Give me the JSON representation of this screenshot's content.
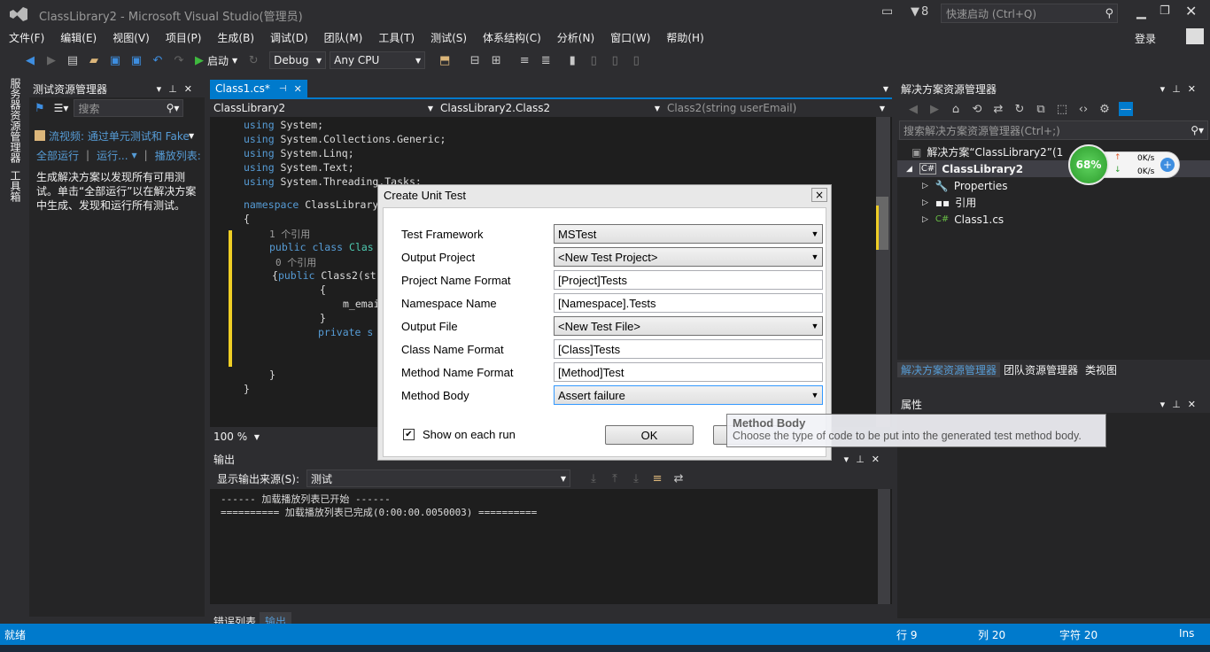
{
  "window": {
    "title": "ClassLibrary2 - Microsoft Visual Studio(管理员)",
    "notify_count": "8",
    "quick_launch": "快速启动 (Ctrl+Q)",
    "login": "登录"
  },
  "menu": [
    "文件(F)",
    "编辑(E)",
    "视图(V)",
    "项目(P)",
    "生成(B)",
    "调试(D)",
    "团队(M)",
    "工具(T)",
    "测试(S)",
    "体系结构(C)",
    "分析(N)",
    "窗口(W)",
    "帮助(H)"
  ],
  "toolbar": {
    "start": "启动",
    "config": "Debug",
    "platform": "Any CPU"
  },
  "side_tabs": {
    "server": "服务器资源管理器",
    "toolbox": "工具箱"
  },
  "test_explorer": {
    "title": "测试资源管理器",
    "search_placeholder": "搜索",
    "video_link": "流视频: 通过单元测试和 Fake",
    "run_all": "全部运行",
    "run": "运行...",
    "playlist": "播放列表:",
    "message": "生成解决方案以发现所有可用测试。单击“全部运行”以在解决方案中生成、发现和运行所有测试。"
  },
  "editor": {
    "tab": "Class1.cs*",
    "nav_project": "ClassLibrary2",
    "nav_class": "ClassLibrary2.Class2",
    "nav_member": "Class2(string userEmail)",
    "zoom": "100 %",
    "lines": [
      {
        "kw": "using",
        "rest": " System;"
      },
      {
        "kw": "using",
        "rest": " System.Collections.Generic;"
      },
      {
        "kw": "using",
        "rest": " System.Linq;"
      },
      {
        "kw": "using",
        "rest": " System.Text;"
      },
      {
        "kw": "using",
        "rest": " System.Threading.Tasks;"
      }
    ],
    "ns_kw": "namespace",
    "ns_name": " ClassLibrary",
    "ref1": "1 个引用",
    "class_kw": "public class",
    "class_name": " Clas",
    "ref0": "0 个引用",
    "ctor_kw": "public",
    "ctor_rest": " Class2(st",
    "assign": "m_emai",
    "private_kw": "private s"
  },
  "output": {
    "title": "输出",
    "source_label": "显示输出来源(S):",
    "source_value": "测试",
    "lines": [
      "------ 加载播放列表已开始 ------",
      "========== 加载播放列表已完成(0:00:00.0050003) =========="
    ],
    "tab_errors": "错误列表",
    "tab_output": "输出"
  },
  "solution_explorer": {
    "title": "解决方案资源管理器",
    "search": "搜索解决方案资源管理器(Ctrl+;)",
    "solution": "解决方案“ClassLibrary2”(1",
    "project": "ClassLibrary2",
    "properties": "Properties",
    "references": "引用",
    "file": "Class1.cs",
    "tabs": [
      "解决方案资源管理器",
      "团队资源管理器",
      "类视图"
    ],
    "properties_panel": "属性"
  },
  "net_widget": {
    "percent": "68%",
    "up": "0K/s",
    "down": "0K/s"
  },
  "dialog": {
    "title": "Create Unit Test",
    "fields": [
      {
        "label": "Test Framework",
        "value": "MSTest",
        "combo": true
      },
      {
        "label": "Output Project",
        "value": "<New Test Project>",
        "combo": true
      },
      {
        "label": "Project Name Format",
        "value": "[Project]Tests",
        "combo": false
      },
      {
        "label": "Namespace Name",
        "value": "[Namespace].Tests",
        "combo": false
      },
      {
        "label": "Output File",
        "value": "<New Test File>",
        "combo": true
      },
      {
        "label": "Class Name Format",
        "value": "[Class]Tests",
        "combo": false
      },
      {
        "label": "Method Name Format",
        "value": "[Method]Test",
        "combo": false
      },
      {
        "label": "Method Body",
        "value": "Assert failure",
        "combo": true
      }
    ],
    "show_each_run": "Show on each run",
    "ok": "OK",
    "close": "×"
  },
  "tooltip": {
    "title": "Method Body",
    "text": "Choose the type of code to be put into the generated test method body."
  },
  "status": {
    "ready": "就绪",
    "line": "行 9",
    "col": "列 20",
    "char": "字符 20",
    "mode": "Ins"
  },
  "colors": {
    "accent": "#007acc",
    "bg": "#2d2d30",
    "panel": "#252526",
    "editor": "#1e1e1e"
  }
}
